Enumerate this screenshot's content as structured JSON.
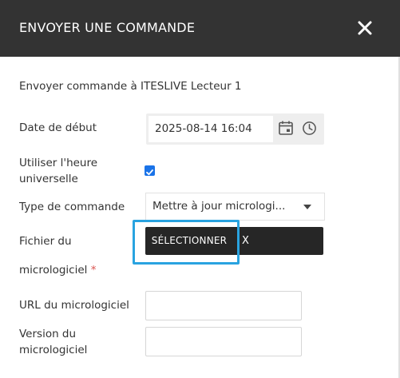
{
  "dialog": {
    "title": "ENVOYER UNE COMMANDE",
    "close_label": "✕"
  },
  "form": {
    "subtitle": "Envoyer commande à ITESLIVE Lecteur 1",
    "start_date": {
      "label": "Date de début",
      "value": "2025-08-14 16:04"
    },
    "utc": {
      "label_line1": "Utiliser l'heure",
      "label_line2": "universelle",
      "checked": true
    },
    "command_type": {
      "label": "Type de commande",
      "selected": "Mettre à jour micrologi..."
    },
    "firmware_file": {
      "label_line1": "Fichier du",
      "label_line2": "micrologiciel",
      "required_mark": "*",
      "button_label": "SÉLECTIONNER",
      "clear_label": "X"
    },
    "firmware_url": {
      "label": "URL du micrologiciel",
      "value": ""
    },
    "firmware_version": {
      "label_line1": "Version du",
      "label_line2": "micrologiciel",
      "value": ""
    }
  },
  "icons": {
    "close": "close-icon",
    "calendar": "calendar-icon",
    "clock": "clock-icon",
    "caret": "caret-down-icon",
    "check": "checkmark-icon"
  },
  "colors": {
    "header_bg": "#333333",
    "accent_blue": "#1a73e8",
    "highlight": "#29a3e0",
    "required": "#d9534f",
    "button_dark": "#262626"
  }
}
